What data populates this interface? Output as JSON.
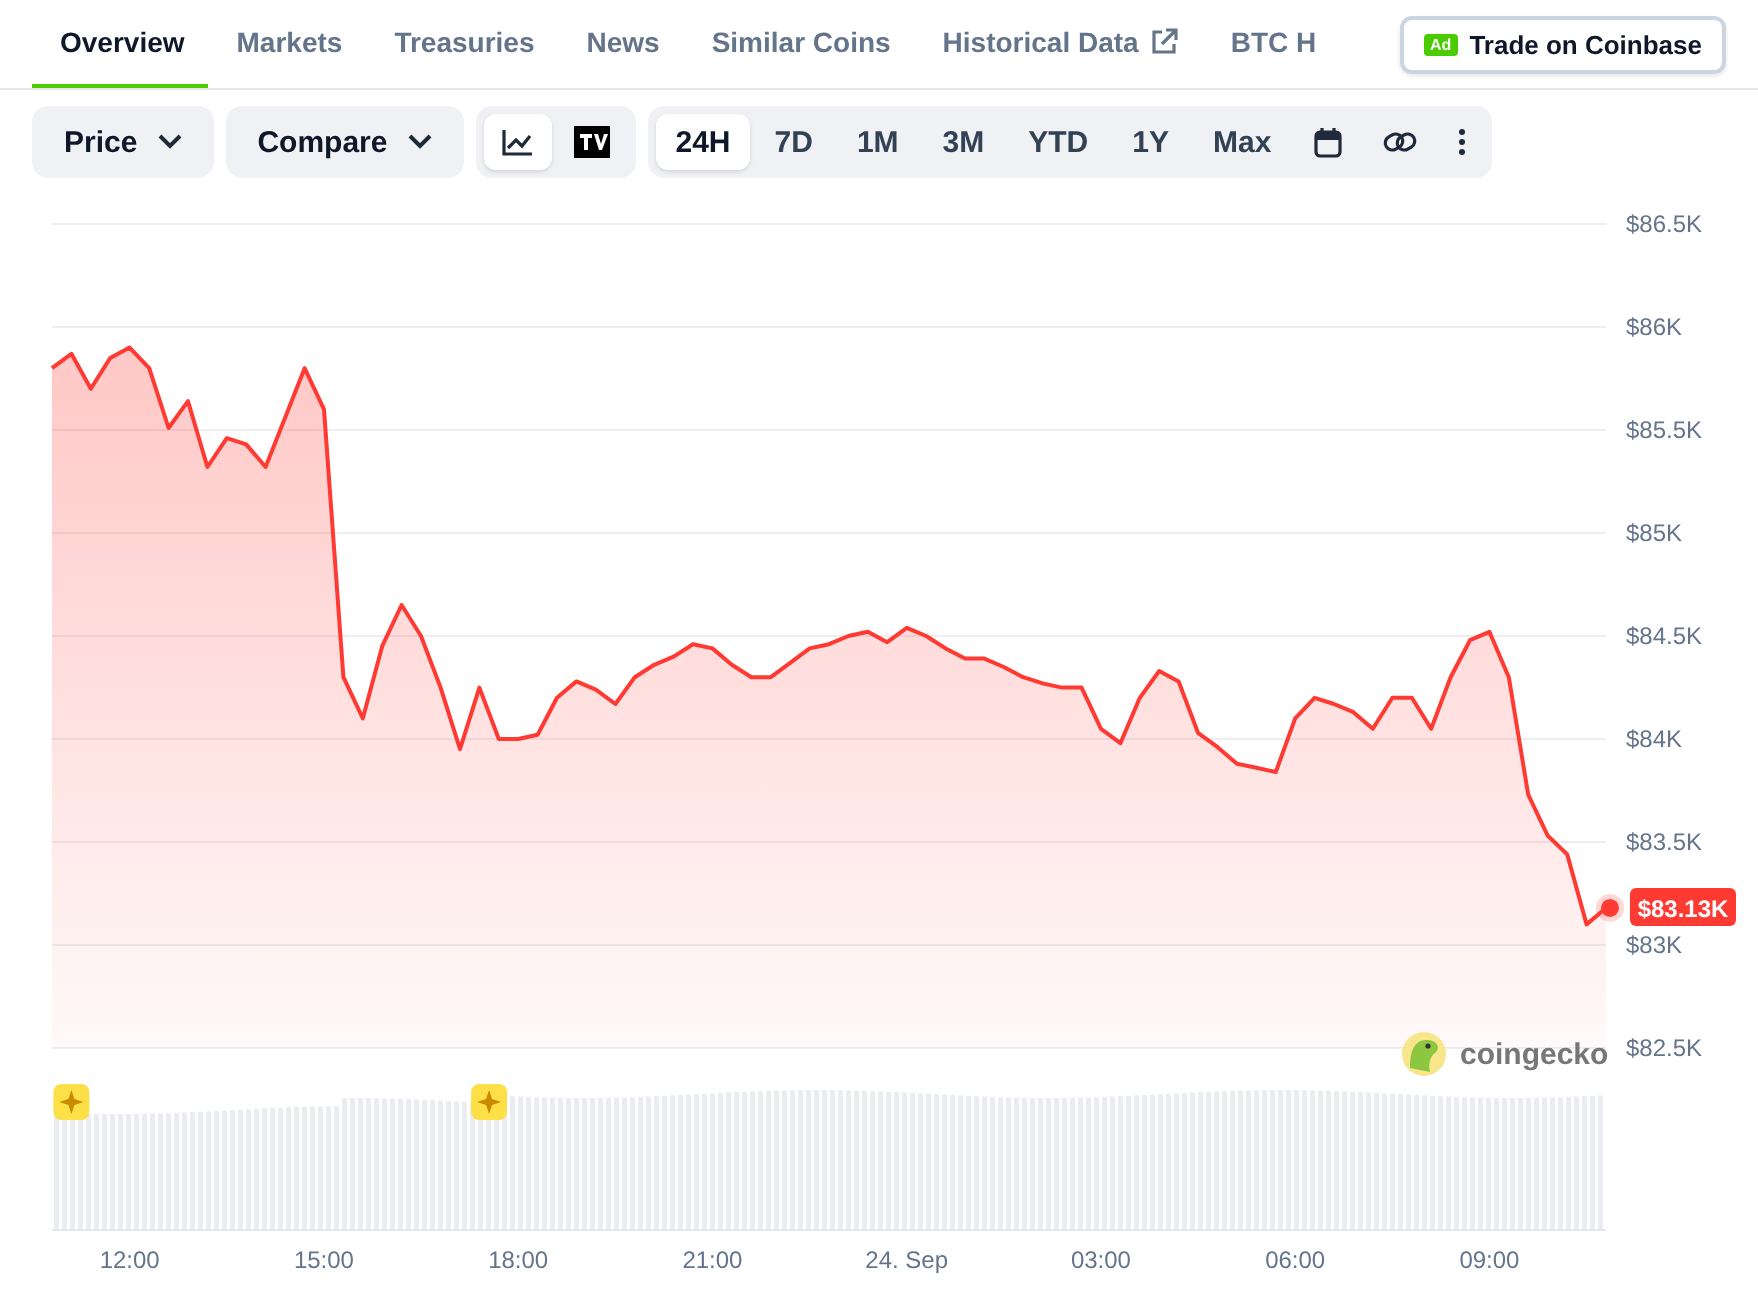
{
  "tabs": [
    {
      "label": "Overview",
      "selected": true,
      "external": false
    },
    {
      "label": "Markets",
      "selected": false,
      "external": false
    },
    {
      "label": "Treasuries",
      "selected": false,
      "external": false
    },
    {
      "label": "News",
      "selected": false,
      "external": false
    },
    {
      "label": "Similar Coins",
      "selected": false,
      "external": false
    },
    {
      "label": "Historical Data",
      "selected": false,
      "external": true
    },
    {
      "label": "BTC H",
      "selected": false,
      "external": false
    }
  ],
  "ad_button": {
    "badge": "Ad",
    "label": "Trade on Coinbase"
  },
  "toolbar": {
    "dropdowns": [
      "Price",
      "Compare"
    ],
    "chart_types": [
      {
        "kind": "line",
        "selected": true
      },
      {
        "kind": "tradingview",
        "selected": false
      }
    ],
    "ranges": [
      {
        "label": "24H",
        "selected": true
      },
      {
        "label": "7D",
        "selected": false
      },
      {
        "label": "1M",
        "selected": false
      },
      {
        "label": "3M",
        "selected": false
      },
      {
        "label": "YTD",
        "selected": false
      },
      {
        "label": "1Y",
        "selected": false
      },
      {
        "label": "Max",
        "selected": false
      }
    ]
  },
  "chart": {
    "current_price": "$83.13K",
    "brand": "coingecko",
    "chart_data": {
      "type": "area",
      "ylim": [
        82.5,
        86.5
      ],
      "categories": [
        null,
        null,
        null,
        null,
        "12:00",
        null,
        null,
        null,
        null,
        null,
        null,
        null,
        null,
        null,
        "15:00",
        null,
        null,
        null,
        null,
        null,
        null,
        null,
        null,
        null,
        "18:00",
        null,
        null,
        null,
        null,
        null,
        null,
        null,
        null,
        null,
        "21:00",
        null,
        null,
        null,
        null,
        null,
        null,
        null,
        null,
        null,
        "24. Sep",
        null,
        null,
        null,
        null,
        null,
        null,
        null,
        null,
        null,
        "03:00",
        null,
        null,
        null,
        null,
        null,
        null,
        null,
        null,
        null,
        "06:00",
        null,
        null,
        null,
        null,
        null,
        null,
        null,
        null,
        null,
        "09:00",
        null,
        null,
        null,
        null,
        null,
        null
      ],
      "series": [
        {
          "color": "#ff3a33",
          "values": [
            85.8,
            85.87,
            85.7,
            85.85,
            85.9,
            85.8,
            85.51,
            85.64,
            85.32,
            85.46,
            85.43,
            85.32,
            85.56,
            85.8,
            85.6,
            84.3,
            84.1,
            84.45,
            84.65,
            84.5,
            84.25,
            83.95,
            84.25,
            84.0,
            84.0,
            84.02,
            84.2,
            84.28,
            84.24,
            84.17,
            84.3,
            84.36,
            84.4,
            84.46,
            84.44,
            84.36,
            84.3,
            84.3,
            84.37,
            84.44,
            84.46,
            84.5,
            84.52,
            84.47,
            84.54,
            84.5,
            84.44,
            84.39,
            84.39,
            84.35,
            84.3,
            84.27,
            84.25,
            84.25,
            84.05,
            83.98,
            84.2,
            84.33,
            84.28,
            84.03,
            83.96,
            83.88,
            83.86,
            83.84,
            84.1,
            84.2,
            84.17,
            84.13,
            84.05,
            84.2,
            84.2,
            84.05,
            84.3,
            84.48,
            84.52,
            84.3,
            83.73,
            83.53,
            83.44,
            83.1,
            83.18
          ]
        }
      ],
      "yticks": [
        {
          "value": 82.5,
          "label": "$82.5K"
        },
        {
          "value": 83,
          "label": "$83K"
        },
        {
          "value": 83.5,
          "label": "$83.5K"
        },
        {
          "value": 84,
          "label": "$84K"
        },
        {
          "value": 84.5,
          "label": "$84.5K"
        },
        {
          "value": 85,
          "label": "$85K"
        },
        {
          "value": 85.5,
          "label": "$85.5K"
        },
        {
          "value": 86,
          "label": "$86K"
        },
        {
          "value": 86.5,
          "label": "$86.5K"
        }
      ],
      "grid": true
    }
  }
}
